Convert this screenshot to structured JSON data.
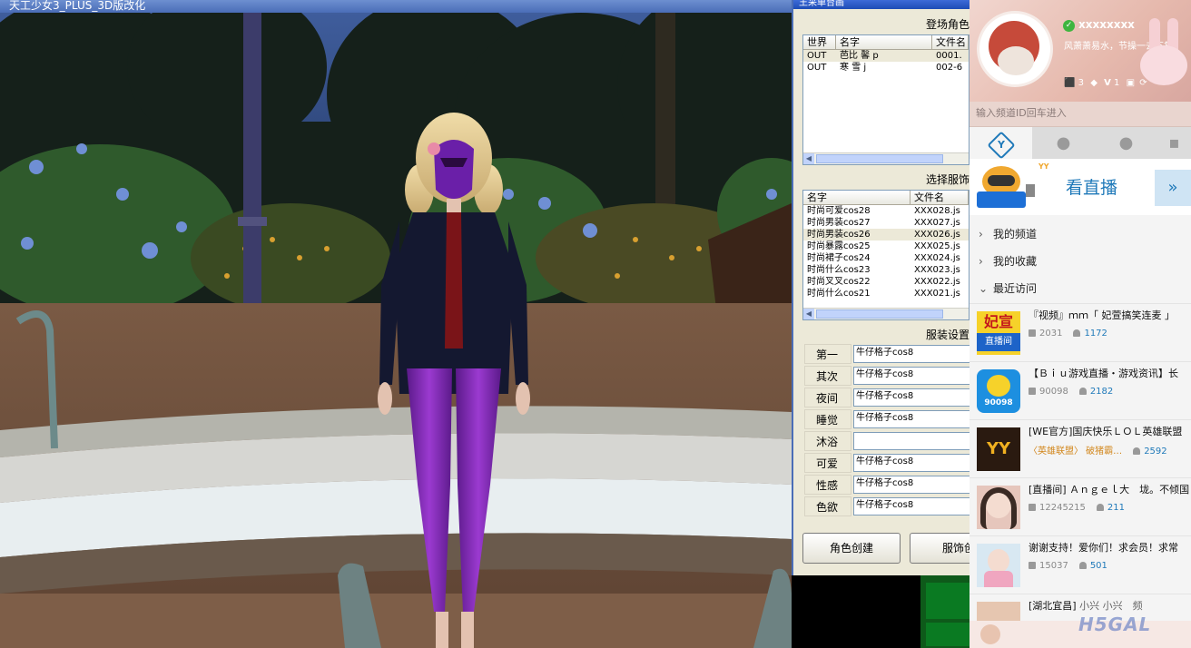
{
  "game": {
    "title": "天工少女3_PLUS_3D版改化"
  },
  "manager": {
    "title": "王采单台画",
    "char_group": {
      "title": "登场角色",
      "columns": [
        "世界",
        "名字",
        "文件名"
      ],
      "rows": [
        {
          "world": "OUT",
          "name": "芭比 馨 p",
          "file": "0001."
        },
        {
          "world": "OUT",
          "name": "寒 雪 j",
          "file": "002-6"
        }
      ]
    },
    "outfit_group": {
      "title": "选择服饰",
      "columns": [
        "名字",
        "文件名"
      ],
      "rows": [
        {
          "name": "时尚可爱cos28",
          "file": "XXX028.js"
        },
        {
          "name": "时尚男装cos27",
          "file": "XXX027.js"
        },
        {
          "name": "时尚男装cos26",
          "file": "XXX026.js"
        },
        {
          "name": "时尚暴露cos25",
          "file": "XXX025.js"
        },
        {
          "name": "时尚裙子cos24",
          "file": "XXX024.js"
        },
        {
          "name": "时尚什么cos23",
          "file": "XXX023.js"
        },
        {
          "name": "时尚叉叉cos22",
          "file": "XXX022.js"
        },
        {
          "name": "时尚什么cos21",
          "file": "XXX021.js"
        }
      ],
      "selected_index": 2
    },
    "settings_group": {
      "title": "服装设置",
      "rows": [
        {
          "label": "第一",
          "value": "牛仔格子cos8"
        },
        {
          "label": "其次",
          "value": "牛仔格子cos8"
        },
        {
          "label": "夜间",
          "value": "牛仔格子cos8"
        },
        {
          "label": "睡觉",
          "value": "牛仔格子cos8"
        },
        {
          "label": "沐浴",
          "value": ""
        },
        {
          "label": "可爱",
          "value": "牛仔格子cos8"
        },
        {
          "label": "性感",
          "value": "牛仔格子cos8"
        },
        {
          "label": "色欲",
          "value": "牛仔格子cos8"
        }
      ]
    },
    "buttons": {
      "create_char": "角色创建",
      "create_outfit": "服饰创"
    }
  },
  "yy": {
    "username": "xxxxxxxx",
    "status_text": "风萧萧易水，节操一去不复",
    "level_a": "3",
    "level_b": "1",
    "vip_letter": "V",
    "search_placeholder": "输入频道ID回车进入",
    "banner_logo": "YY",
    "banner_text": "看直播",
    "nav": [
      "我的频道",
      "我的收藏",
      "最近访问"
    ],
    "channels": [
      {
        "thumb_text": "妃宣",
        "thumb_sub": "直播间",
        "title": "『视频』ｍｍ「 妃萱搞笑连麦 」",
        "a": "2031",
        "b": "1172"
      },
      {
        "thumb_text": "90098",
        "title": "【Ｂｉｕ游戏直播・游戏资讯】长",
        "a": "90098",
        "b": "2182"
      },
      {
        "thumb_text": "YY",
        "title": "[WE官方]国庆快乐ＬＯＬ英雄联盟",
        "sub": "〈英雄联盟〉 破猪霸…",
        "b": "2592"
      },
      {
        "title": "[直播间] Ａｎｇｅｌ大　垅。不倾国",
        "a": "12245215",
        "b": "211"
      },
      {
        "title": "谢谢支持！爱你们！求会员！求常",
        "a": "15037",
        "b": "501"
      },
      {
        "title": "[湖北宜昌]",
        "extra": "小兴 小兴　频"
      }
    ],
    "watermark": "H5GAL"
  },
  "colors": {
    "accent_blue": "#1f79b9",
    "panel_bg": "#ece9d8"
  }
}
